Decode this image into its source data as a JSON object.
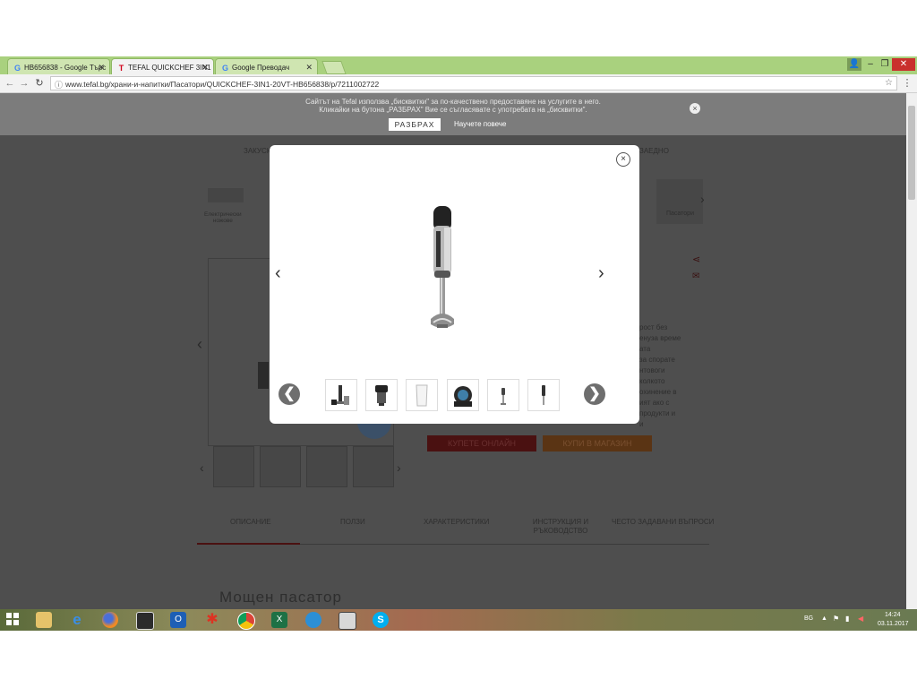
{
  "browser": {
    "tabs": [
      {
        "title": "HB656838 - Google Търс",
        "favicon": "G"
      },
      {
        "title": "TEFAL QUICKCHEF 3IN1",
        "favicon": "T"
      },
      {
        "title": "Google Преводач",
        "favicon": "G"
      }
    ],
    "url": "www.tefal.bg/храни-и-напитки/Пасатори/QUICKCHEF-3IN1-20VT-HB656838/p/7211002722"
  },
  "cookie_bar": {
    "line1": "Сайтът на Tefal използва „бисквитки\" за по-качествено предоставяне на услугите в него.",
    "line2": "Кликайки на бутона „РАЗБРАХ\" Вие се съгласявате с употребата на „бисквитки\".",
    "accept_label": "РАЗБРАХ",
    "more_label": "Научете повече",
    "close_icon": "×"
  },
  "background": {
    "menu_left": "ЗАКУСКА",
    "menu_right": "ЗАЕДНО",
    "category_1": "Електрически\nножове",
    "category_2": "Пасатори",
    "right_text": [
      "рост без",
      "енуза време",
      "ата",
      "за спорате",
      "нтовоги",
      "колкото",
      "охинение в",
      "ият ако с",
      "продукти и",
      "и"
    ],
    "buy_online": "КУПЕТЕ ОНЛАЙН",
    "buy_store": "КУПИ В МАГАЗИН",
    "tabs": [
      "ОПИСАНИЕ",
      "ПОЛЗИ",
      "ХАРАКТЕРИСТИКИ",
      "ИНСТРУКЦИЯ И РЪКОВОДСТВО",
      "ЧЕСТО ЗАДАВАНИ ВЪПРОСИ"
    ],
    "heading": "Мощен пасатор"
  },
  "modal": {
    "prev": "‹",
    "next": "›",
    "close": "×",
    "thumb_prev": "❮",
    "thumb_next": "❯"
  },
  "taskbar": {
    "lang": "BG",
    "time": "14:24",
    "date": "03.11.2017"
  }
}
